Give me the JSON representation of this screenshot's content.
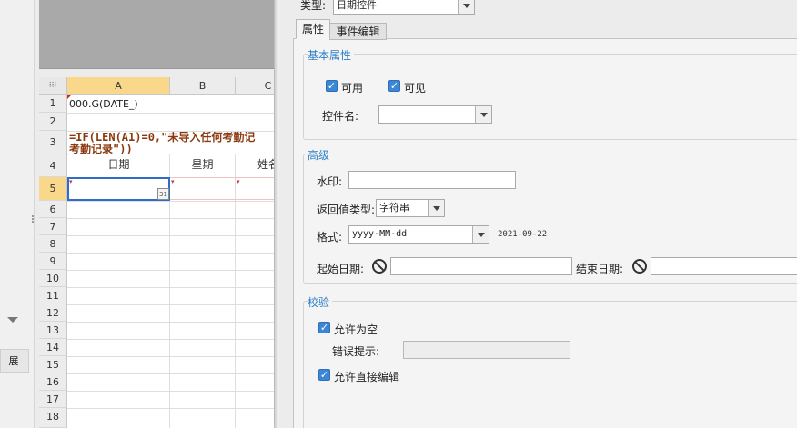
{
  "left_panel": {
    "tab_label": "展"
  },
  "sheet": {
    "columns": [
      "A",
      "B",
      "C"
    ],
    "rows": [
      "1",
      "2",
      "3",
      "4",
      "5",
      "6",
      "7",
      "8",
      "9",
      "10",
      "11",
      "12",
      "13",
      "14",
      "15",
      "16",
      "17",
      "18"
    ],
    "a1": "000.G(DATE_)",
    "a3_formula_line1": "=IF(LEN(A1)=0,\"未导入任何考勤记",
    "a3_formula_line2": "考勤记录\"))",
    "header_date": "日期",
    "header_weekday": "星期",
    "header_name": "姓名",
    "date_icon_text": "31"
  },
  "panel": {
    "type_label": "类型:",
    "type_value": "日期控件",
    "tabs": [
      "属性",
      "事件编辑"
    ],
    "basic": {
      "title": "基本属性",
      "enabled_label": "可用",
      "visible_label": "可见",
      "control_name_label": "控件名:"
    },
    "advanced": {
      "title": "高级",
      "watermark_label": "水印:",
      "return_type_label": "返回值类型:",
      "return_type_value": "字符串",
      "format_label": "格式:",
      "format_value": "yyyy-MM-dd",
      "format_preview": "2021-09-22",
      "start_date_label": "起始日期:",
      "end_date_label": "结束日期:"
    },
    "validation": {
      "title": "校验",
      "allow_empty_label": "允许为空",
      "error_hint_label": "错误提示:",
      "allow_direct_edit_label": "允许直接编辑"
    }
  }
}
